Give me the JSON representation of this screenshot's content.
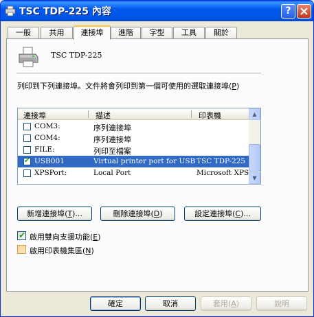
{
  "window": {
    "title": "TSC TDP-225 內容",
    "help_button": "?",
    "close_button": "X"
  },
  "tabs": [
    {
      "label": "一般"
    },
    {
      "label": "共用"
    },
    {
      "label": "連接埠"
    },
    {
      "label": "進階"
    },
    {
      "label": "字型"
    },
    {
      "label": "工具"
    },
    {
      "label": "關於"
    }
  ],
  "printer": {
    "name": "TSC TDP-225",
    "icon": "printer-icon"
  },
  "description": {
    "text": "列印到下列連接埠。文件將會列印到第一個可使用的選取連接埠",
    "accel_open": "(",
    "accel": "P",
    "accel_close": ")"
  },
  "ports_table": {
    "columns": [
      "連接埠",
      "描述",
      "印表機"
    ],
    "rows": [
      {
        "port": "COM3:",
        "description": "序列連接埠",
        "printer": "",
        "checked": false,
        "selected": false
      },
      {
        "port": "COM4:",
        "description": "序列連接埠",
        "printer": "",
        "checked": false,
        "selected": false
      },
      {
        "port": "FILE:",
        "description": "列印至檔案",
        "printer": "",
        "checked": false,
        "selected": false
      },
      {
        "port": "USB001",
        "description": "Virtual printer port for USB",
        "printer": "TSC TDP-225",
        "checked": true,
        "selected": true
      },
      {
        "port": "XPSPort:",
        "description": "Local Port",
        "printer": "Microsoft XPS D",
        "checked": false,
        "selected": false
      }
    ]
  },
  "port_buttons": {
    "add": {
      "text": "新增連接埠",
      "accel": "T",
      "suffix": "..."
    },
    "delete": {
      "text": "刪除連接埠",
      "accel": "D",
      "suffix": ""
    },
    "configure": {
      "text": "設定連接埠",
      "accel": "C",
      "suffix": "..."
    }
  },
  "options": {
    "bidirectional": {
      "label": "啟用雙向支援功能",
      "accel": "E",
      "checked": true
    },
    "pooling": {
      "label": "啟用印表機集區",
      "accel": "N",
      "checked": false
    }
  },
  "footer": {
    "ok": "確定",
    "cancel": "取消",
    "apply": {
      "text": "套用",
      "accel": "A"
    },
    "help": "說明"
  },
  "colors": {
    "titlebar": "#0058ee",
    "selection": "#316ac5",
    "dialog_bg": "#ece9d8",
    "active_tab_accent": "#ffc83c"
  }
}
